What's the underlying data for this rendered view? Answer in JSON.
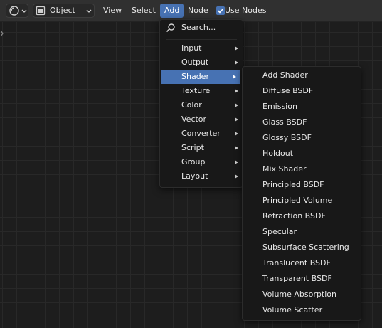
{
  "header": {
    "mode_value": "Object",
    "menus": [
      "View",
      "Select",
      "Add",
      "Node"
    ],
    "use_nodes_label": "Use Nodes",
    "use_nodes_checked": true
  },
  "add_menu": {
    "search_placeholder": "Search...",
    "items": [
      "Input",
      "Output",
      "Shader",
      "Texture",
      "Color",
      "Vector",
      "Converter",
      "Script",
      "Group",
      "Layout"
    ],
    "highlighted": "Shader"
  },
  "shader_menu": {
    "items": [
      "Add Shader",
      "Diffuse BSDF",
      "Emission",
      "Glass BSDF",
      "Glossy BSDF",
      "Holdout",
      "Mix Shader",
      "Principled BSDF",
      "Principled Volume",
      "Refraction BSDF",
      "Specular",
      "Subsurface Scattering",
      "Translucent BSDF",
      "Transparent BSDF",
      "Volume Absorption",
      "Volume Scatter"
    ]
  },
  "colors": {
    "accent": "#4772b3",
    "menu_bg": "#181818",
    "header_bg": "#303030",
    "canvas_bg": "#1d1d1d"
  }
}
